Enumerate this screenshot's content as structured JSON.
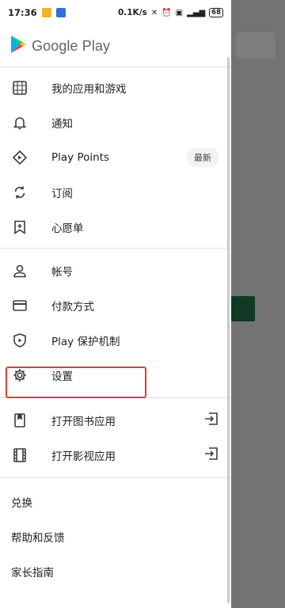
{
  "statusbar": {
    "time": "17:36",
    "net_speed": "0.1K/s",
    "battery": "68"
  },
  "drawer": {
    "logo_text": "Google Play",
    "section1": [
      {
        "label": "我的应用和游戏",
        "icon": "apps-grid-icon"
      },
      {
        "label": "通知",
        "icon": "bell-icon"
      },
      {
        "label": "Play Points",
        "icon": "diamond-icon",
        "badge": "最新"
      },
      {
        "label": "订阅",
        "icon": "refresh-icon"
      },
      {
        "label": "心愿单",
        "icon": "bookmark-plus-icon"
      }
    ],
    "section2": [
      {
        "label": "帐号",
        "icon": "person-icon"
      },
      {
        "label": "付款方式",
        "icon": "credit-card-icon"
      },
      {
        "label": "Play 保护机制",
        "icon": "shield-play-icon"
      },
      {
        "label": "设置",
        "icon": "gear-icon"
      }
    ],
    "section3": [
      {
        "label": "打开图书应用",
        "icon": "book-icon",
        "tail_icon": "open-external-icon"
      },
      {
        "label": "打开影视应用",
        "icon": "film-icon",
        "tail_icon": "open-external-icon"
      }
    ],
    "section4": [
      {
        "label": "兑换"
      },
      {
        "label": "帮助和反馈"
      },
      {
        "label": "家长指南"
      }
    ]
  },
  "colors": {
    "highlight": "#e53935",
    "backdrop": "#737373"
  }
}
